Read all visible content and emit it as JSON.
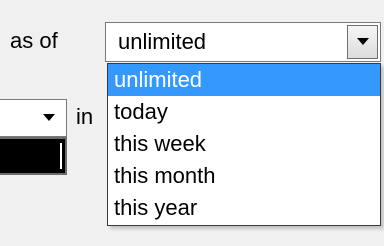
{
  "filter": {
    "as_of_label": "as of",
    "period_value": "unlimited",
    "in_label": "in"
  },
  "dropdown": {
    "options": [
      {
        "label": "unlimited",
        "selected": true
      },
      {
        "label": "today",
        "selected": false
      },
      {
        "label": "this week",
        "selected": false
      },
      {
        "label": "this month",
        "selected": false
      },
      {
        "label": "this year",
        "selected": false
      }
    ]
  },
  "colors": {
    "selection": "#3399ff",
    "background": "#f0f0f0"
  },
  "icons": {
    "dropdown_button": "chevron-down-icon",
    "small_select": "chevron-down-icon"
  }
}
